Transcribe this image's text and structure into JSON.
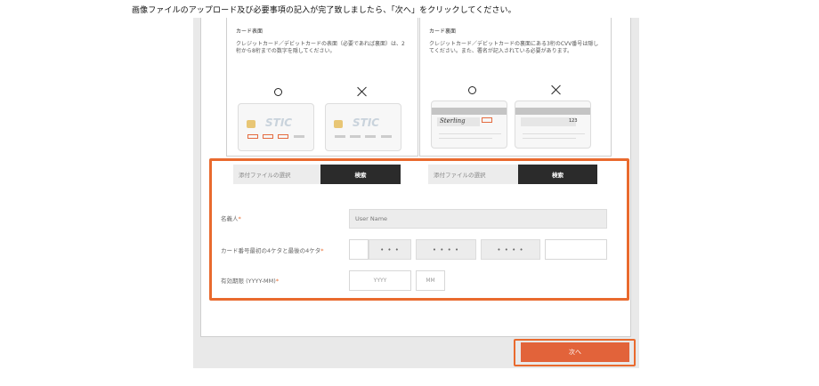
{
  "instruction": "画像ファイルのアップロード及び必要事項の記入が完了致しましたら、「次へ」をクリックしてください。",
  "front_card": {
    "title": "カード表面",
    "description": "クレジットカード／デビットカードの表面（必要であれば裏面）は、2桁から8桁までの数字を隠してください。",
    "ok_brand": "STIC",
    "ng_brand": "STIC"
  },
  "back_card": {
    "title": "カード裏面",
    "description": "クレジットカード／デビットカードの裏面にある3桁のCVV番号は隠してください。また、署名が記入されている必要があります。",
    "signature": "Sterling",
    "cvv": "123"
  },
  "upload": {
    "placeholder": "添付ファイルの選択",
    "button_label": "検索"
  },
  "form": {
    "name_label": "名義人",
    "name_placeholder": "User Name",
    "card_number_label": "カード番号最初の4ケタと最後の4ケタ",
    "card_dots": [
      "• • •",
      "• • • •",
      "• • • •"
    ],
    "expiry_label": "有効期限 (YYYY-MM)",
    "year_placeholder": "YYYY",
    "month_placeholder": "MM",
    "required_mark": "*"
  },
  "next_button": "次へ",
  "colors": {
    "accent": "#e96a2e",
    "dark_button": "#2b2b2b"
  }
}
